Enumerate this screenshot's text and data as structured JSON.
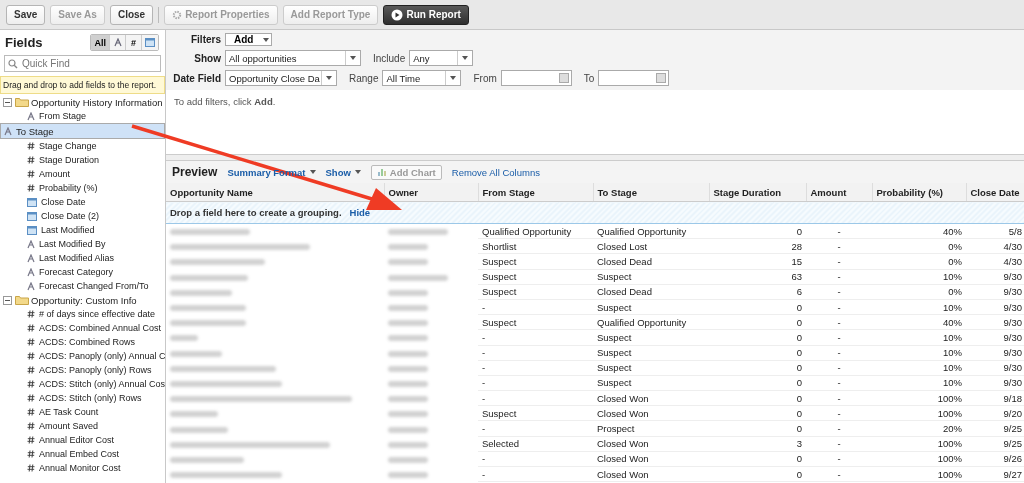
{
  "toolbar": [
    {
      "label": "Save",
      "kind": "plain",
      "disabled": false
    },
    {
      "label": "Save As",
      "kind": "plain",
      "disabled": true
    },
    {
      "label": "Close",
      "kind": "plain",
      "disabled": false
    },
    {
      "label": "Report Properties",
      "kind": "gear",
      "disabled": true
    },
    {
      "label": "Add Report Type",
      "kind": "plain",
      "disabled": true
    },
    {
      "label": "Run Report",
      "kind": "run",
      "disabled": false
    }
  ],
  "fields_panel": {
    "title": "Fields",
    "filters": [
      {
        "kind": "all",
        "label": "All",
        "selected": true
      },
      {
        "kind": "text",
        "selected": false
      },
      {
        "kind": "number",
        "label": "#",
        "selected": false
      },
      {
        "kind": "date",
        "selected": false
      }
    ],
    "search": {
      "placeholder": "Quick Find"
    },
    "hint": "Drag and drop to add fields to the report.",
    "tree": [
      {
        "label": "Opportunity History Information",
        "expanded": true,
        "children": [
          {
            "label": "From Stage",
            "kind": "text",
            "selected": false
          },
          {
            "label": "To Stage",
            "kind": "text",
            "selected": true
          },
          {
            "label": "Stage Change",
            "kind": "number",
            "selected": false
          },
          {
            "label": "Stage Duration",
            "kind": "number",
            "selected": false
          },
          {
            "label": "Amount",
            "kind": "number",
            "selected": false
          },
          {
            "label": "Probability (%)",
            "kind": "number",
            "selected": false
          },
          {
            "label": "Close Date",
            "kind": "date",
            "selected": false
          },
          {
            "label": "Close Date (2)",
            "kind": "date",
            "selected": false
          },
          {
            "label": "Last Modified",
            "kind": "date",
            "selected": false
          },
          {
            "label": "Last Modified By",
            "kind": "text",
            "selected": false
          },
          {
            "label": "Last Modified Alias",
            "kind": "text",
            "selected": false
          },
          {
            "label": "Forecast Category",
            "kind": "text",
            "selected": false
          },
          {
            "label": "Forecast Changed From/To",
            "kind": "text",
            "selected": false
          }
        ]
      },
      {
        "label": "Opportunity: Custom Info",
        "expanded": true,
        "children": [
          {
            "label": "# of days since effective date",
            "kind": "number",
            "selected": false
          },
          {
            "label": "ACDS: Combined Annual Cost",
            "kind": "number",
            "selected": false
          },
          {
            "label": "ACDS: Combined Rows",
            "kind": "number",
            "selected": false
          },
          {
            "label": "ACDS: Panoply (only) Annual C",
            "kind": "number",
            "selected": false
          },
          {
            "label": "ACDS: Panoply (only) Rows",
            "kind": "number",
            "selected": false
          },
          {
            "label": "ACDS: Stitch (only) Annual Cos",
            "kind": "number",
            "selected": false
          },
          {
            "label": "ACDS: Stitch (only) Rows",
            "kind": "number",
            "selected": false
          },
          {
            "label": "AE Task Count",
            "kind": "number",
            "selected": false
          },
          {
            "label": "Amount Saved",
            "kind": "number",
            "selected": false
          },
          {
            "label": "Annual Editor Cost",
            "kind": "number",
            "selected": false
          },
          {
            "label": "Annual Embed Cost",
            "kind": "number",
            "selected": false
          },
          {
            "label": "Annual Monitor Cost",
            "kind": "number",
            "selected": false
          }
        ]
      }
    ]
  },
  "filters": {
    "label": "Filters",
    "add_button": "Add",
    "show_label": "Show",
    "show_value": "All opportunities",
    "include_label": "Include",
    "include_value": "Any",
    "date_field_label": "Date Field",
    "date_field_value": "Opportunity Close Da",
    "range_label": "Range",
    "range_value": "All Time",
    "from_label": "From",
    "to_label": "To",
    "message": "To add filters, click **Add**."
  },
  "preview": {
    "title": "Preview",
    "format": "Summary Format",
    "show": "Show",
    "add_chart": "Add Chart",
    "remove_columns": "Remove All Columns",
    "columns": [
      "Opportunity Name",
      "Owner",
      "From Stage",
      "To Stage",
      "Stage Duration",
      "Amount",
      "Probability (%)",
      "Close Date"
    ],
    "grouping_hint": "Drop a field here to create a grouping.",
    "hide_link": "Hide",
    "rows": [
      [
        "",
        "",
        "Qualified Opportunity",
        "Qualified Opportunity",
        "0",
        "-",
        "40%",
        "5/8"
      ],
      [
        "",
        "",
        "Shortlist",
        "Closed Lost",
        "28",
        "-",
        "0%",
        "4/30"
      ],
      [
        "",
        "",
        "Suspect",
        "Closed Dead",
        "15",
        "-",
        "0%",
        "4/30"
      ],
      [
        "",
        "",
        "Suspect",
        "Suspect",
        "63",
        "-",
        "10%",
        "9/30"
      ],
      [
        "",
        "",
        "Suspect",
        "Closed Dead",
        "6",
        "-",
        "0%",
        "9/30"
      ],
      [
        "",
        "",
        "-",
        "Suspect",
        "0",
        "-",
        "10%",
        "9/30"
      ],
      [
        "",
        "",
        "Suspect",
        "Qualified Opportunity",
        "0",
        "-",
        "40%",
        "9/30"
      ],
      [
        "",
        "",
        "-",
        "Suspect",
        "0",
        "-",
        "10%",
        "9/30"
      ],
      [
        "",
        "",
        "-",
        "Suspect",
        "0",
        "-",
        "10%",
        "9/30"
      ],
      [
        "",
        "",
        "-",
        "Suspect",
        "0",
        "-",
        "10%",
        "9/30"
      ],
      [
        "",
        "",
        "-",
        "Suspect",
        "0",
        "-",
        "10%",
        "9/30"
      ],
      [
        "",
        "",
        "-",
        "Closed Won",
        "0",
        "-",
        "100%",
        "9/18"
      ],
      [
        "",
        "",
        "Suspect",
        "Closed Won",
        "0",
        "-",
        "100%",
        "9/20"
      ],
      [
        "",
        "",
        "-",
        "Prospect",
        "0",
        "-",
        "20%",
        "9/25"
      ],
      [
        "",
        "",
        "Selected",
        "Closed Won",
        "3",
        "-",
        "100%",
        "9/25"
      ],
      [
        "",
        "",
        "-",
        "Closed Won",
        "0",
        "-",
        "100%",
        "9/26"
      ],
      [
        "",
        "",
        "-",
        "Closed Won",
        "0",
        "-",
        "100%",
        "9/27"
      ]
    ]
  }
}
